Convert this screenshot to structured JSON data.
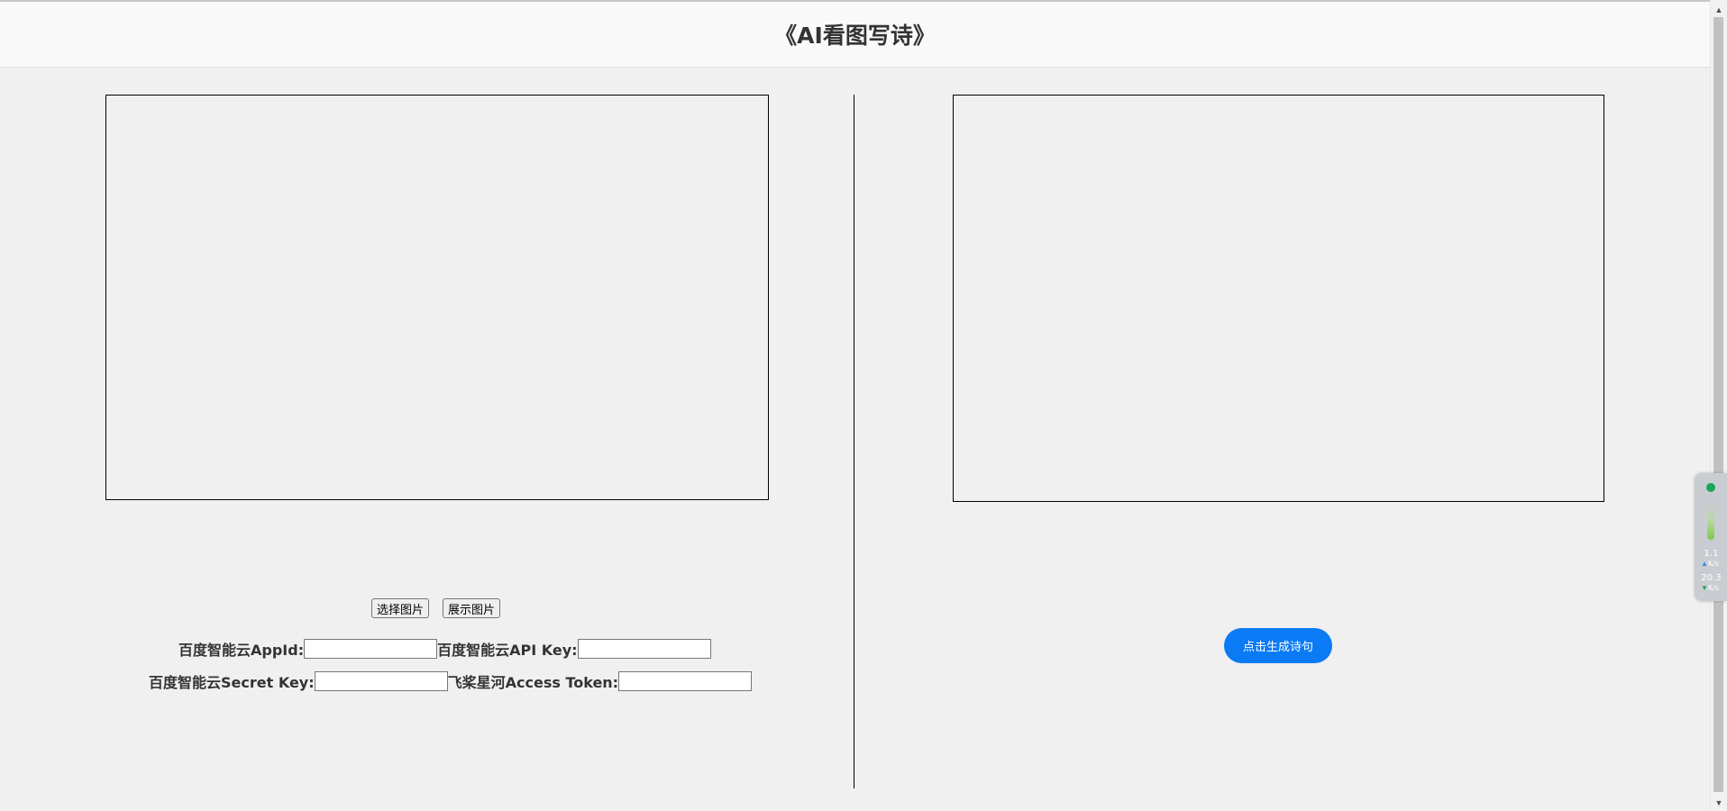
{
  "header": {
    "title": "《AI看图写诗》"
  },
  "left_panel": {
    "select_image_label": "选择图片",
    "show_image_label": "展示图片",
    "fields": {
      "appid_label": "百度智能云AppId:",
      "appid_value": "",
      "apikey_label": "百度智能云API Key:",
      "apikey_value": "",
      "secretkey_label": "百度智能云Secret Key:",
      "secretkey_value": "",
      "token_label": "飞桨星河Access Token:",
      "token_value": ""
    }
  },
  "right_panel": {
    "generate_label": "点击生成诗句"
  },
  "net_widget": {
    "upload_speed": "1.1",
    "upload_unit": "K/s",
    "download_speed": "20.3",
    "download_unit": "K/s"
  },
  "colors": {
    "accent": "#0a7bf5",
    "background": "#f0f0f0",
    "header_bg": "#f9f9f9"
  }
}
